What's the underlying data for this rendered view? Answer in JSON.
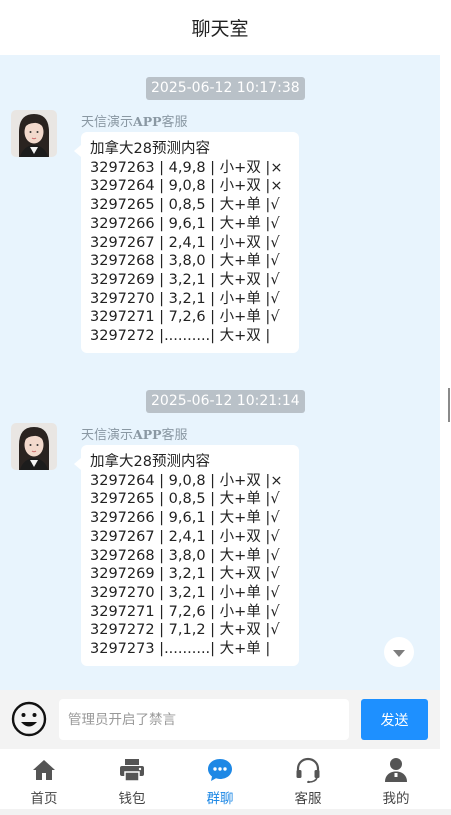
{
  "header": {
    "title": "聊天室"
  },
  "messages": [
    {
      "timestamp": "2025-06-12 10:17:38",
      "sender_prefix": "天信演示",
      "sender_app": "APP",
      "sender_suffix": "客服",
      "lines": [
        "加拿大28预测内容",
        "3297263 | 4,9,8 | 小+双 |×",
        "3297264 | 9,0,8 | 小+双 |×",
        "3297265 | 0,8,5 | 大+单 |√",
        "3297266 | 9,6,1 | 大+单 |√",
        "3297267 | 2,4,1 | 小+双 |√",
        "3297268 | 3,8,0 | 大+单 |√",
        "3297269 | 3,2,1 | 大+双 |√",
        "3297270 | 3,2,1 | 小+单 |√",
        "3297271 | 7,2,6 | 小+单 |√",
        "3297272 |..........| 大+双 |"
      ]
    },
    {
      "timestamp": "2025-06-12 10:21:14",
      "sender_prefix": "天信演示",
      "sender_app": "APP",
      "sender_suffix": "客服",
      "lines": [
        "加拿大28预测内容",
        "3297264 | 9,0,8 | 小+双 |×",
        "3297265 | 0,8,5 | 大+单 |√",
        "3297266 | 9,6,1 | 大+单 |√",
        "3297267 | 2,4,1 | 小+双 |√",
        "3297268 | 3,8,0 | 大+单 |√",
        "3297269 | 3,2,1 | 大+双 |√",
        "3297270 | 3,2,1 | 小+单 |√",
        "3297271 | 7,2,6 | 小+单 |√",
        "3297272 | 7,1,2 | 大+双 |√",
        "3297273 |..........| 大+单 |"
      ]
    }
  ],
  "composer": {
    "placeholder": "管理员开启了禁言",
    "send_label": "发送",
    "emoji_icon": "smiley-face-icon"
  },
  "tabs": [
    {
      "label": "首页",
      "icon": "home-icon",
      "active": false
    },
    {
      "label": "钱包",
      "icon": "printer-icon",
      "active": false
    },
    {
      "label": "群聊",
      "icon": "chat-bubble-icon",
      "active": true
    },
    {
      "label": "客服",
      "icon": "headset-icon",
      "active": false
    },
    {
      "label": "我的",
      "icon": "user-icon",
      "active": false
    }
  ],
  "colors": {
    "chat_background": "#e8f4fd",
    "accent": "#1e88e5",
    "send_button": "#1e90ff",
    "timestamp_badge": "#b9c1c8"
  }
}
